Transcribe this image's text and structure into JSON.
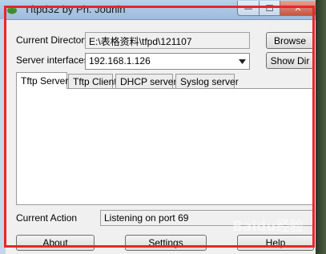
{
  "window": {
    "title": "Tftpd32 by Ph. Jounin"
  },
  "titlebar": {
    "minimize_symbol": "—",
    "maximize_symbol": "☐",
    "close_symbol": "✕"
  },
  "fields": {
    "current_directory_label": "Current Directory",
    "current_directory_value": "E:\\表格资料\\tfpd\\121107",
    "server_interfaces_label": "Server interfaces",
    "server_interfaces_value": "192.168.1.126",
    "current_action_label": "Current Action",
    "current_action_value": "Listening on port 69"
  },
  "buttons": {
    "browse": "Browse",
    "show_dir": "Show Dir",
    "about": "About",
    "settings": "Settings",
    "help": "Help"
  },
  "tabs": [
    {
      "label": "Tftp Server",
      "active": true
    },
    {
      "label": "Tftp Client",
      "active": false
    },
    {
      "label": "DHCP server",
      "active": false
    },
    {
      "label": "Syslog server",
      "active": false
    }
  ],
  "watermark": "Baidu经验",
  "icons": {
    "app": "frog-app-icon",
    "dropdown": "chevron-down-icon"
  },
  "colors": {
    "highlight_outline": "#e8262a"
  }
}
